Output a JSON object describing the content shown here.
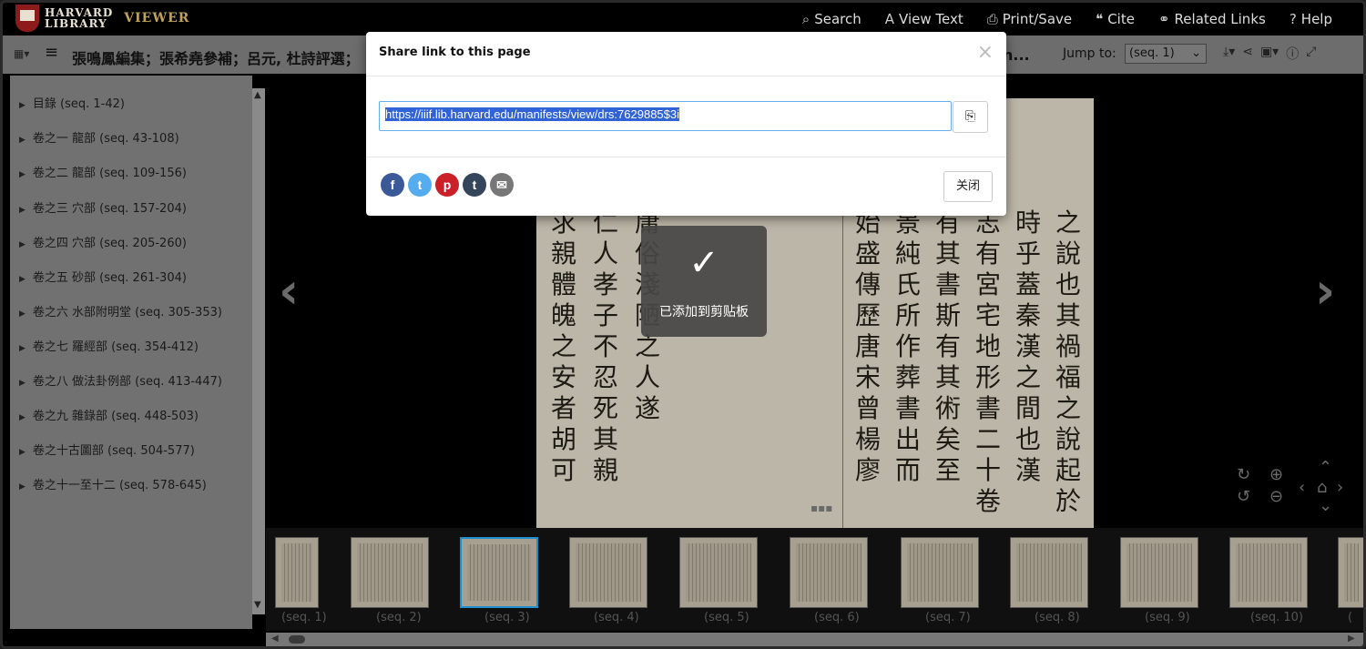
{
  "header": {
    "logo_line1": "HARVARD",
    "logo_line2": "LIBRARY",
    "logo_viewer": "VIEWER",
    "nav": [
      {
        "label": "Search",
        "icon": "search-icon"
      },
      {
        "label": "View Text",
        "icon": "text-icon"
      },
      {
        "label": "Print/Save",
        "icon": "printer-icon"
      },
      {
        "label": "Cite",
        "icon": "quote-icon"
      },
      {
        "label": "Related Links",
        "icon": "link-icon"
      },
      {
        "label": "Help",
        "icon": "help-icon"
      }
    ]
  },
  "titlebar": {
    "title": "張鳴鳳編集；張希堯參補；呂元, 杜詩評選；",
    "title_tail": "n...",
    "jump_label": "Jump to:",
    "jump_value": "(seq. 1)"
  },
  "sidebar": {
    "items": [
      {
        "label": "目錄 (seq. 1-42)"
      },
      {
        "label": "卷之一 龍部 (seq. 43-108)"
      },
      {
        "label": "卷之二 龍部 (seq. 109-156)"
      },
      {
        "label": "卷之三 穴部 (seq. 157-204)"
      },
      {
        "label": "卷之四 穴部 (seq. 205-260)"
      },
      {
        "label": "卷之五 砂部 (seq. 261-304)"
      },
      {
        "label": "卷之六 水部附明堂 (seq. 305-353)"
      },
      {
        "label": "卷之七 羅經部 (seq. 354-412)"
      },
      {
        "label": "卷之八 做法卦例部 (seq. 413-447)"
      },
      {
        "label": "卷之九 雜錄部 (seq. 448-503)"
      },
      {
        "label": "卷之十古圖部 (seq. 504-577)"
      },
      {
        "label": "卷之十一至十二 (seq. 578-645)"
      }
    ]
  },
  "thumbnails": {
    "labels": [
      "(seq. 1)",
      "(seq. 2)",
      "(seq. 3)",
      "(seq. 4)",
      "(seq. 5)",
      "(seq. 6)",
      "(seq. 7)",
      "(seq. 8)",
      "(seq. 9)",
      "(seq. 10)",
      "("
    ],
    "selected": "(seq. 3)"
  },
  "modal": {
    "title": "Share link to this page",
    "close_symbol": "×",
    "url": "https://iiif.lib.harvard.edu/manifests/view/drs:7629885$3i",
    "copy_icon": "clipboard-icon",
    "share": [
      {
        "name": "facebook",
        "glyph": "f",
        "color": "#3b5998"
      },
      {
        "name": "twitter",
        "glyph": "t",
        "color": "#55acee"
      },
      {
        "name": "pinterest",
        "glyph": "p",
        "color": "#cb2027"
      },
      {
        "name": "tumblr",
        "glyph": "t",
        "color": "#35465c"
      },
      {
        "name": "email",
        "glyph": "✉",
        "color": "#777777"
      }
    ],
    "close_button": "关闭"
  },
  "toast": {
    "text": "已添加到剪贴板"
  },
  "page_text": {
    "columns": [
      "之說也其禍福之說起於",
      "時乎蓋秦漢之間也漢",
      "志有宮宅地形書二十卷",
      "有其書斯有其術矣至",
      "景純氏所作葬書出而",
      "始盛傳歷唐宋曾楊廖",
      "求親體魄之安者胡可",
      "仁人孝子不忍死其親",
      "庸俗淺陋之人遂"
    ]
  }
}
